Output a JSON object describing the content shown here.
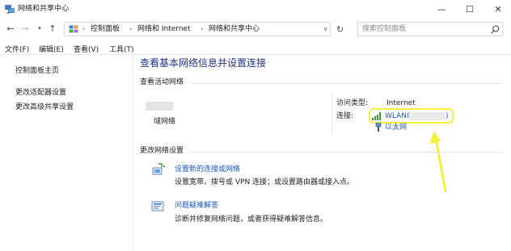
{
  "window": {
    "title": "网络和共享中心",
    "minimize_glyph": "—",
    "maximize_glyph": "☐",
    "close_glyph": "✕"
  },
  "nav": {
    "back_glyph": "←",
    "forward_glyph": "→",
    "dropdown_glyph": "▾",
    "up_glyph": "↑"
  },
  "address": {
    "sep_glyph": "›",
    "crumbs": [
      "控制面板",
      "网络和 Internet",
      "网络和共享中心"
    ],
    "dropdown_glyph": "∨",
    "refresh_glyph": "↻"
  },
  "search": {
    "placeholder": "搜索控制面板"
  },
  "menu": {
    "items": [
      "文件(F)",
      "编辑(E)",
      "查看(V)",
      "工具(T)"
    ]
  },
  "sidebar": {
    "items": [
      "控制面板主页",
      "更改适配器设置",
      "更改高级共享设置"
    ]
  },
  "main": {
    "title": "查看基本网络信息并设置连接",
    "active_networks_heading": "查看活动网络",
    "network_type": "域网络",
    "access_type_label": "访问类型:",
    "access_type_value": "Internet",
    "connections_label": "连接:",
    "wlan_label": "WLAN",
    "wlan_paren_open": "(",
    "wlan_paren_close": ")",
    "ethernet_label": "以太网",
    "change_settings_heading": "更改网络设置",
    "tasks": [
      {
        "title": "设置新的连接或网络",
        "desc": "设置宽带、拨号或 VPN 连接；或设置路由器或接入点。"
      },
      {
        "title": "问题疑难解答",
        "desc": "诊断并修复网络问题，或者获得疑难解答信息。"
      }
    ]
  },
  "colors": {
    "link": "#1a56c8",
    "title_blue": "#1e3287",
    "highlight": "#f5f03a",
    "wifi_green": "#3f9a3a"
  },
  "icons": [
    "network-sharing-icon",
    "search-icon",
    "wifi-signal-icon",
    "ethernet-icon",
    "new-connection-icon",
    "troubleshoot-icon",
    "annotation-arrow"
  ]
}
